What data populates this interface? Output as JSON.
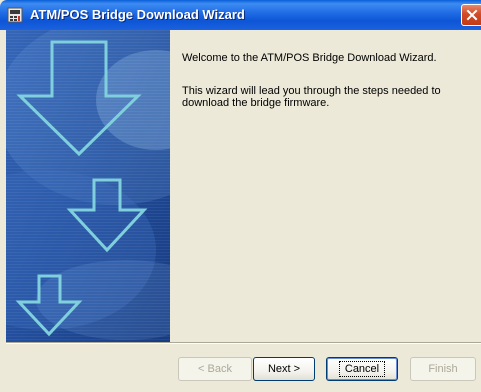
{
  "window": {
    "title": "ATM/POS Bridge Download Wizard"
  },
  "content": {
    "welcome": "Welcome to the ATM/POS Bridge Download Wizard.",
    "description": "This wizard will lead you through the steps needed to download the bridge firmware."
  },
  "buttons": {
    "back": "< Back",
    "next": "Next >",
    "cancel": "Cancel",
    "finish": "Finish"
  },
  "icons": {
    "title": "wizard-app-icon",
    "close": "close-icon",
    "arrows": "download-arrow-icon"
  },
  "colors": {
    "titlebar": "#0d55d6",
    "panel_blue": "#2a5aa8",
    "panel_dark": "#1d3f86",
    "arrow": "#7fd0dc",
    "window_bg": "#ece9d8",
    "close": "#d24a26"
  }
}
